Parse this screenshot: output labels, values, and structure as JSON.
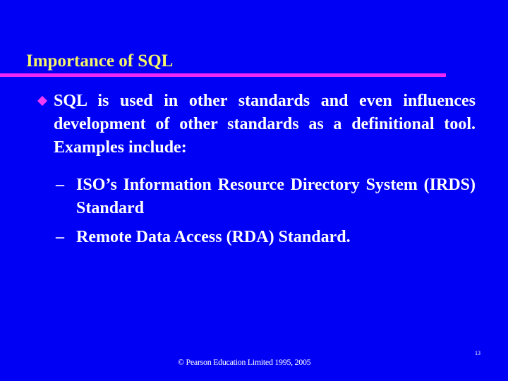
{
  "slide": {
    "title": "Importance of SQL",
    "bullet_icon": "diamond-bullet",
    "main_point": "SQL is used in other standards and even influences development of other standards as a definitional tool. Examples include:",
    "sub_points": [
      {
        "dash": "–",
        "text": "ISO’s Information Resource Directory System (IRDS) Standard"
      },
      {
        "dash": "–",
        "text": "Remote Data Access (RDA) Standard."
      }
    ],
    "footer": "© Pearson Education Limited 1995, 2005",
    "page_number": "13"
  },
  "colors": {
    "background": "#0000f5",
    "title": "#f5f56a",
    "rule": "#f028f5",
    "bullet": "#f03cf5",
    "body_text": "#ffffff"
  }
}
